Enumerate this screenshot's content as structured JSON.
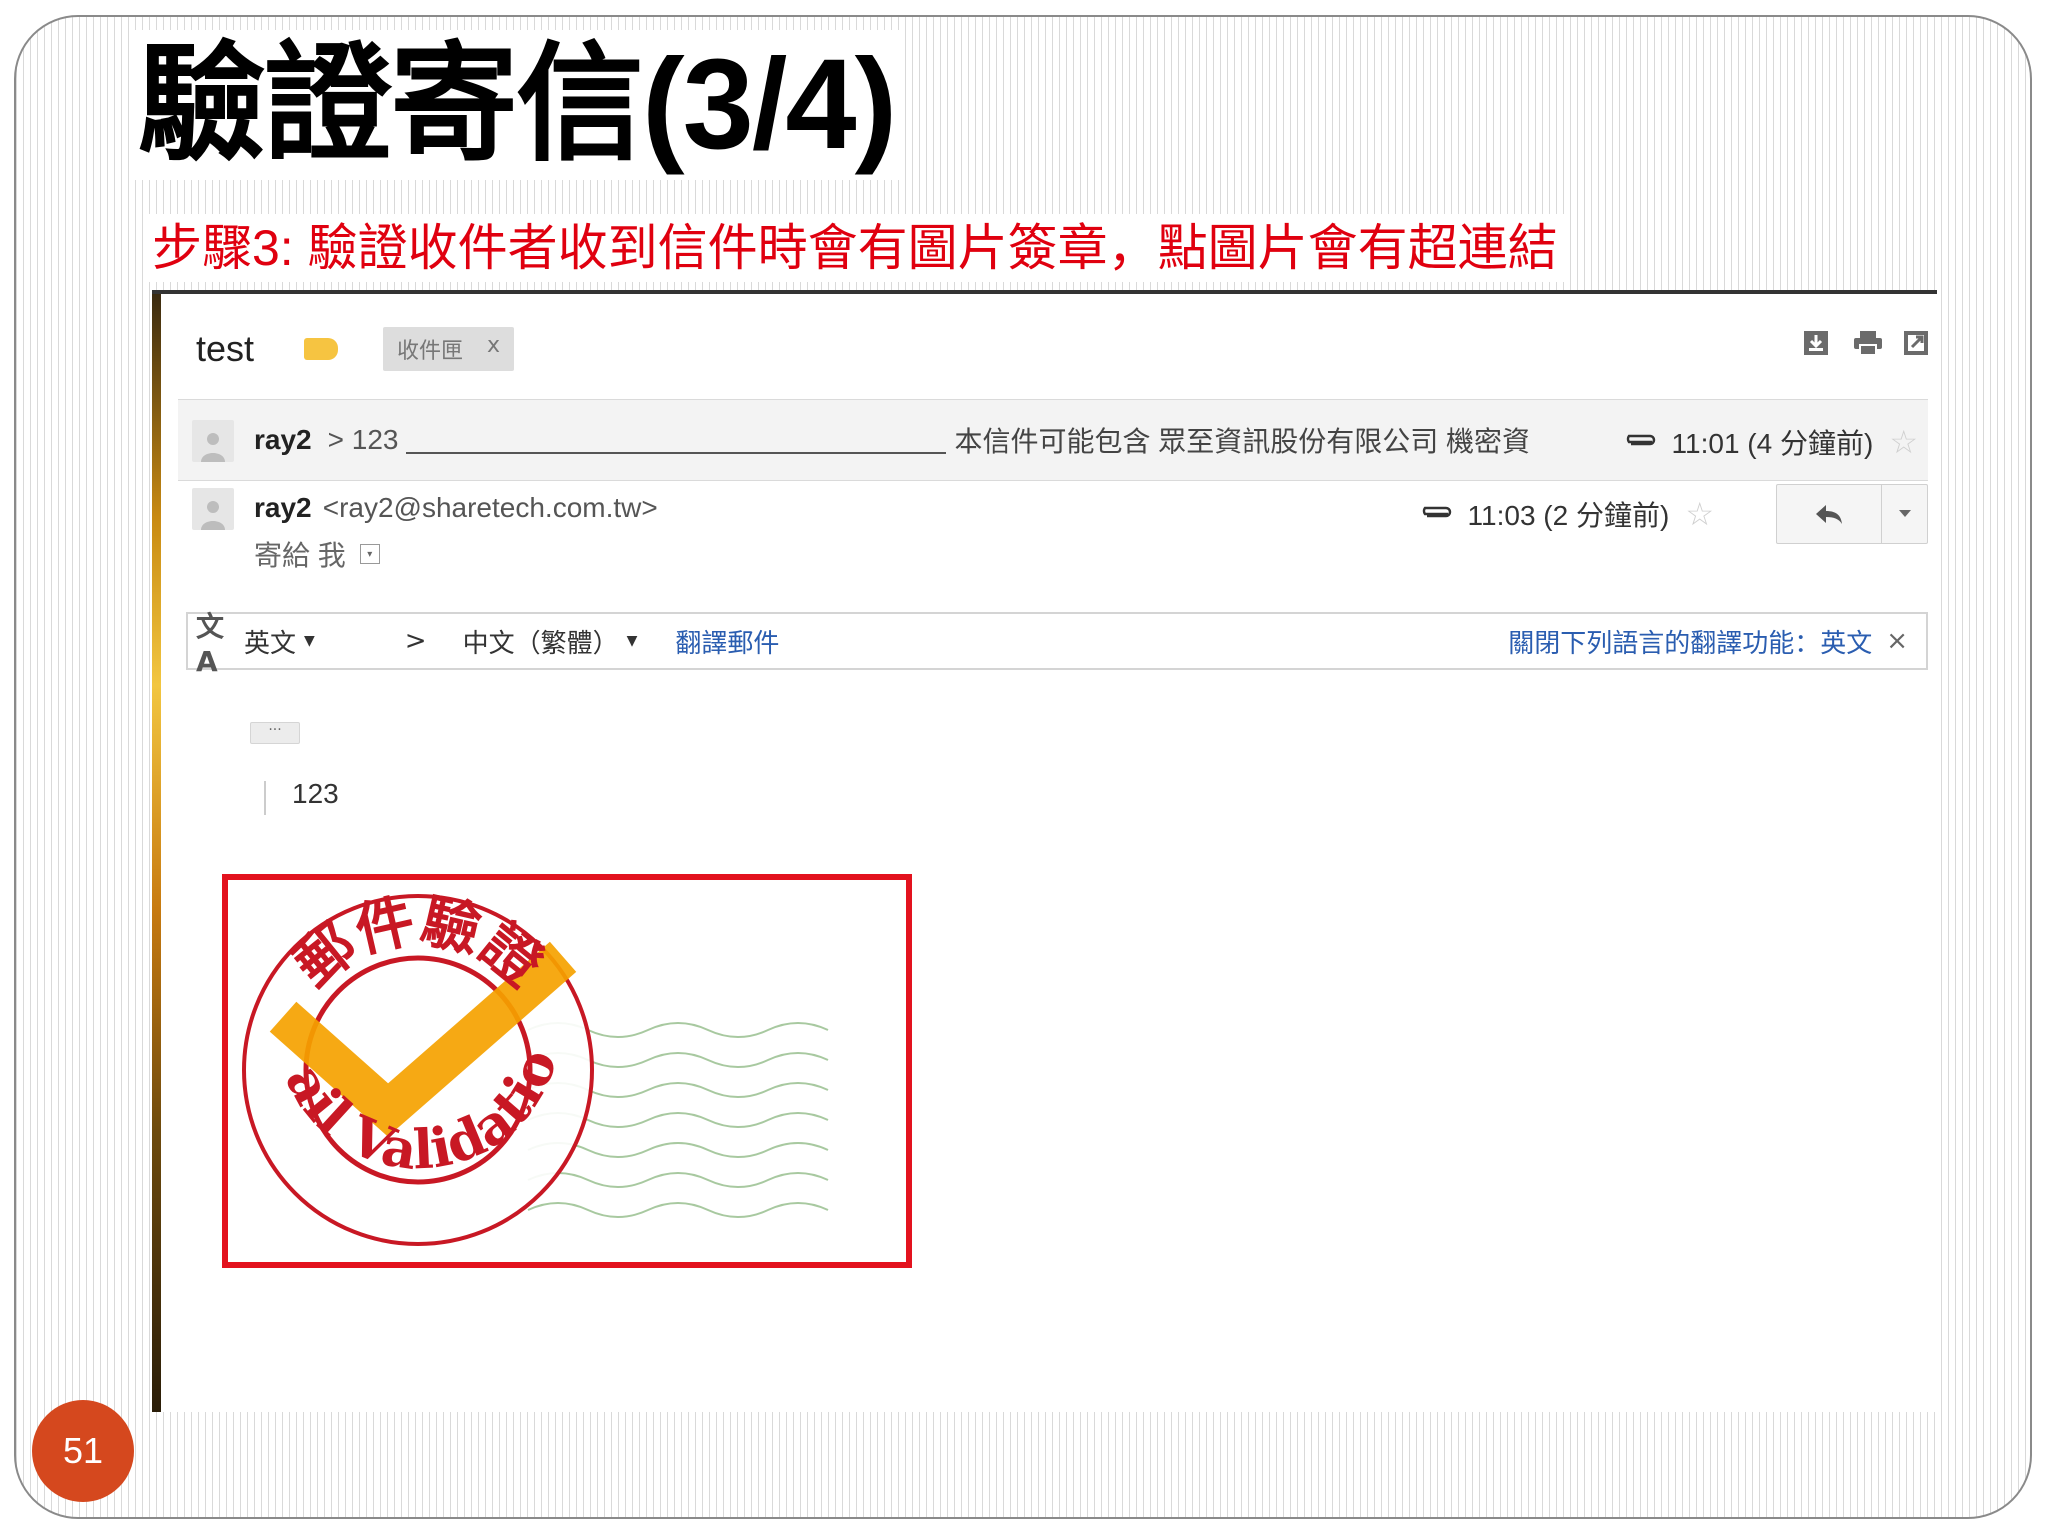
{
  "slide": {
    "title": "驗證寄信(3/4)",
    "subtitle": "步驟3: 驗證收件者收到信件時會有圖片簽章，點圖片會有超連結",
    "page_number": "51"
  },
  "email": {
    "subject": "test",
    "inbox_label": "收件匣",
    "inbox_label_close": "x",
    "collapsed_message": {
      "sender": "ray2",
      "snippet_prefix": "> 123",
      "snippet_text": "本信件可能包含 眾至資訊股份有限公司 機密資",
      "time": "11:01 (4 分鐘前)"
    },
    "expanded_message": {
      "sender": "ray2",
      "sender_email": "<ray2@sharetech.com.tw>",
      "recipient_line": "寄給 我",
      "time": "11:03 (2 分鐘前)"
    },
    "translate_bar": {
      "source_lang": "英文",
      "arrow": ">",
      "target_lang": "中文（繁體）",
      "translate_link": "翻譯郵件",
      "disable_link": "關閉下列語言的翻譯功能：英文",
      "close": "×"
    },
    "ellipsis": "···",
    "body_text": "123",
    "stamp": {
      "top_text": "郵件驗證",
      "bottom_text": "Mail Validation"
    }
  },
  "colors": {
    "title_red": "#e0000f",
    "page_badge": "#d5481e",
    "stamp_red": "#cc1020",
    "check_orange": "#f5a200",
    "label_yellow": "#f6c441",
    "link_blue": "#2a5db0"
  },
  "icons": [
    "download-icon",
    "print-icon",
    "new-window-icon",
    "star-icon",
    "paperclip-icon",
    "reply-icon",
    "more-options-icon",
    "translate-icon",
    "person-icon"
  ]
}
